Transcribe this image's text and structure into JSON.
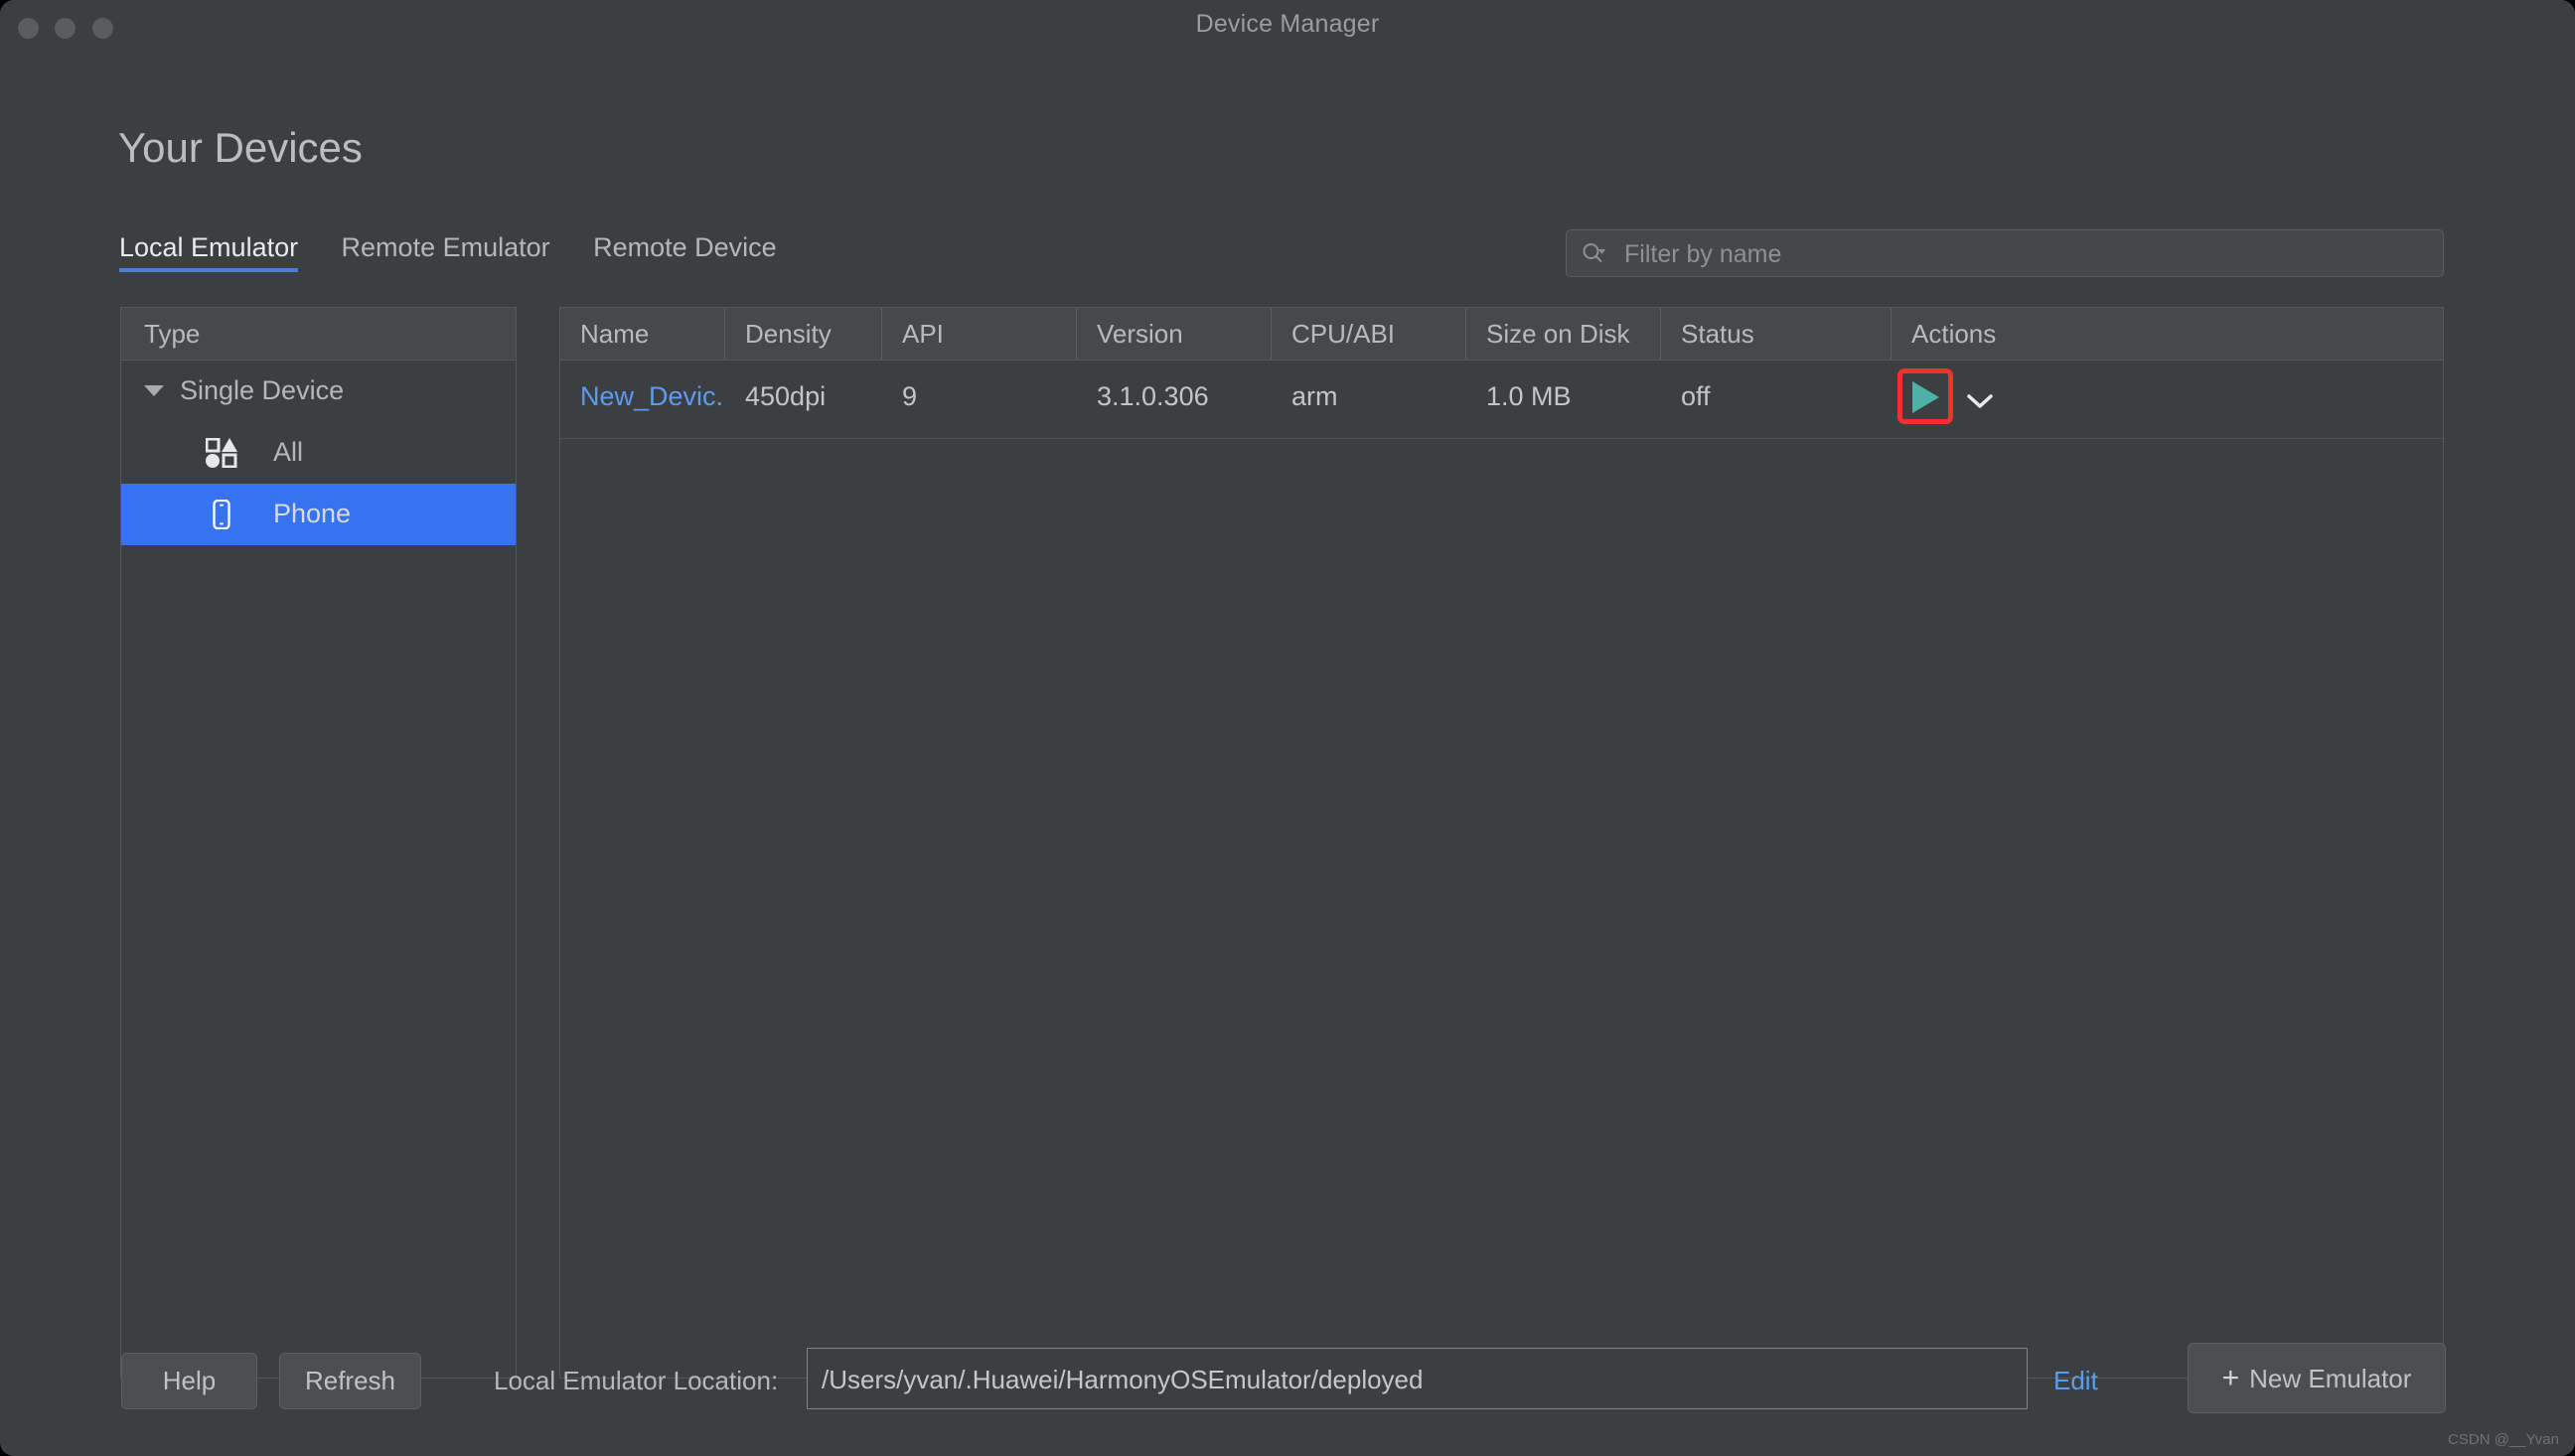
{
  "window": {
    "title": "Device Manager",
    "traffic_lights": [
      "close",
      "minimize",
      "maximize"
    ]
  },
  "page": {
    "title": "Your Devices"
  },
  "tabs": [
    {
      "label": "Local Emulator",
      "active": true
    },
    {
      "label": "Remote Emulator",
      "active": false
    },
    {
      "label": "Remote Device",
      "active": false
    }
  ],
  "search": {
    "placeholder": "Filter by name",
    "value": "",
    "icon": "search-icon"
  },
  "type_panel": {
    "header": "Type",
    "items": [
      {
        "label": "Single Device",
        "kind": "group",
        "expanded": true,
        "icon": "chevron-down-icon"
      },
      {
        "label": "All",
        "kind": "leaf",
        "selected": false,
        "icon": "all-devices-icon"
      },
      {
        "label": "Phone",
        "kind": "leaf",
        "selected": true,
        "icon": "phone-icon"
      }
    ]
  },
  "table": {
    "columns": [
      "Name",
      "Density",
      "API",
      "Version",
      "CPU/ABI",
      "Size on Disk",
      "Status",
      "Actions"
    ],
    "rows": [
      {
        "name": "New_Devic...",
        "density": "450dpi",
        "api": "9",
        "version": "3.1.0.306",
        "cpu_abi": "arm",
        "size_on_disk": "1.0 MB",
        "status": "off",
        "actions": {
          "run": "run-icon",
          "more": "chevron-down-icon",
          "highlighted": true
        }
      }
    ]
  },
  "bottom_bar": {
    "help_label": "Help",
    "refresh_label": "Refresh",
    "location_label": "Local Emulator Location:",
    "location_value": "/Users/yvan/.Huawei/HarmonyOSEmulator/deployed",
    "edit_label": "Edit",
    "new_emulator_label": "New Emulator",
    "new_emulator_plus": "+"
  },
  "watermark": "CSDN @__Yvan",
  "colors": {
    "window_bg": "#3c3f41",
    "header_bg": "#46494b",
    "selection_blue": "#3573f0",
    "link_blue": "#5b9bf0",
    "tab_underline": "#4a7dd8",
    "run_teal": "#4eb0a6",
    "highlight_red": "#f0332a",
    "text": "#c3c5c7"
  }
}
